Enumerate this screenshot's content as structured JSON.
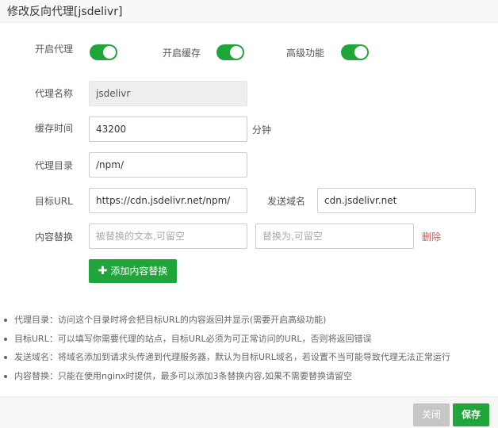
{
  "title": "修改反向代理[jsdelivr]",
  "toggles": {
    "proxy": {
      "label": "开启代理",
      "on": true
    },
    "cache": {
      "label": "开启缓存",
      "on": true
    },
    "advanced": {
      "label": "高级功能",
      "on": true
    }
  },
  "fields": {
    "proxy_name": {
      "label": "代理名称",
      "value": "jsdelivr"
    },
    "cache_time": {
      "label": "缓存时间",
      "value": "43200",
      "unit": "分钟"
    },
    "proxy_dir": {
      "label": "代理目录",
      "value": "/npm/"
    },
    "target_url": {
      "label": "目标URL",
      "value": "https://cdn.jsdelivr.net/npm/"
    },
    "send_domain": {
      "label": "发送域名",
      "value": "cdn.jsdelivr.net"
    },
    "replace": {
      "label": "内容替换",
      "from_placeholder": "被替换的文本,可留空",
      "to_placeholder": "替换为,可留空",
      "delete_label": "删除"
    }
  },
  "add_replace_label": "添加内容替换",
  "tips": [
    "代理目录：访问这个目录时将会把目标URL的内容返回并显示(需要开启高级功能)",
    "目标URL：可以填写你需要代理的站点，目标URL必须为可正常访问的URL，否则将返回错误",
    "发送域名：将域名添加到请求头传递到代理服务器，默认为目标URL域名，若设置不当可能导致代理无法正常运行",
    "内容替换：只能在使用nginx时提供，最多可以添加3条替换内容,如果不需要替换请留空"
  ],
  "footer": {
    "close_label": "关闭",
    "save_label": "保存"
  },
  "colors": {
    "accent": "#20a53a",
    "danger": "#d9534f",
    "disabled_button": "#c6c6c6"
  }
}
